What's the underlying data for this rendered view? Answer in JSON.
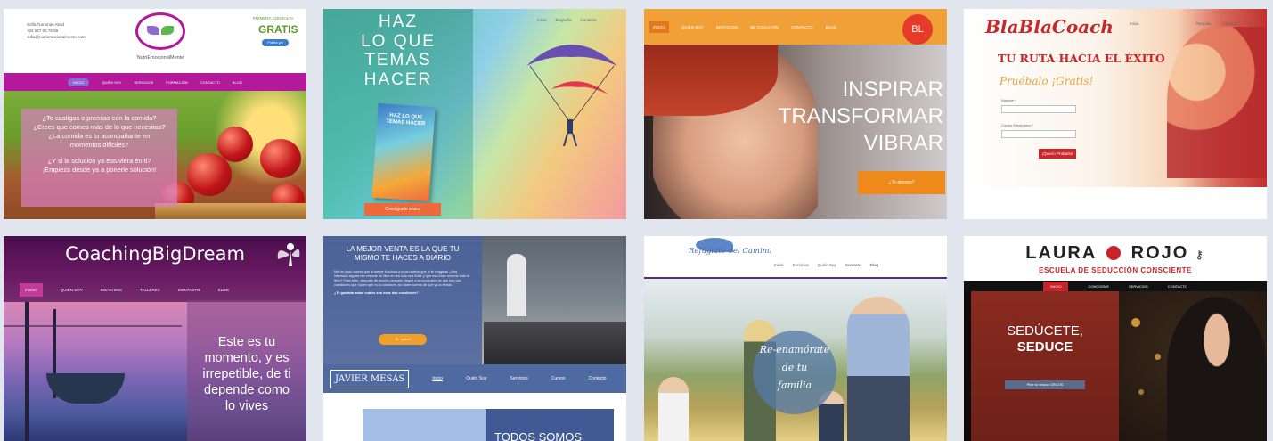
{
  "colors": {
    "page_bg": "#e1e6ee",
    "magenta": "#b31a9b",
    "orange": "#f0a037",
    "purple": "#6a1a63",
    "blue": "#4f6aa1",
    "red": "#c7242b"
  },
  "tiles": [
    {
      "name": "NutriEmocionalMente",
      "contact_name": "Sofía Turrionas Abad",
      "contact_phone": "+34 627 05 78 59",
      "contact_email": "sofia@nutriemocionalmente.com",
      "logo_text": "NutriEmocionalMente",
      "promo_1": "PRIMERA CONSULTA",
      "promo_2": "GRATIS",
      "promo_button": "Pídela ya!",
      "nav": [
        "INICIO",
        "QUIÉN SOY",
        "SERVICIOS",
        "FORMACIÓN",
        "CONTACTO",
        "BLOG"
      ],
      "quote": [
        "¿Te castigas o premias con la comida?",
        "¿Crees que comes más de lo que necesitas?",
        "¿La comida es tu acompañante en",
        "momentos difíciles?",
        "",
        "¿Y si la solución ya estuviera en ti?",
        "¡Empieza desde ya a ponerle solución!"
      ]
    },
    {
      "name": "Haz lo que temas hacer",
      "headline": [
        "HAZ",
        "LO QUE",
        "TEMAS",
        "HACER"
      ],
      "book_title": "HAZ LO QUE TEMAS HACER",
      "nav": [
        "Inicio",
        "Biografía",
        "Contacto"
      ],
      "cta": "Consíguelo ahora"
    },
    {
      "name": "Inspirar Transformar Vibrar",
      "nav": [
        "INICIO",
        "QUIÉN SOY",
        "SERVICIOS",
        "BE COACH ON",
        "CONTACTO",
        "BLOG"
      ],
      "mark": "BL",
      "lines": [
        "INSPIRAR",
        "TRANSFORMAR",
        "VIBRAR"
      ],
      "cta": "¿Te atreves?"
    },
    {
      "name": "BlaBlaCoach",
      "brand": "BlaBlaCoach",
      "nav": [
        "Inicio",
        "Terapias",
        "Contacto",
        "Blog"
      ],
      "headline": "TU RUTA HACIA EL ÉXITO",
      "subhead": "Pruébalo ¡Gratis!",
      "field_1": "Nombre *",
      "field_2": "Correo Electrónico *",
      "button": "¡Quiero Probarlo!"
    },
    {
      "name": "CoachingBigDream",
      "brand": "CoachingBigDream",
      "nav": [
        "INICIO",
        "QUIÉN SOY",
        "COACHING",
        "TALLERES",
        "CONTACTO",
        "BLOG"
      ],
      "message": [
        "Este es tu",
        "momento, y es",
        "irrepetible, de ti",
        "depende como",
        "lo vives"
      ]
    },
    {
      "name": "Javier Mesas",
      "headline": "LA MEJOR VENTA ES LA QUE TU MISMO TE HACES A DIARIO",
      "body": "Me he dado cuenta que la mente funciona a unos niveles que ni te imaginas ¿Has intentado alguna vez resumir un libro en tan solo una frase y que esa frase resuma todo el libro? Pues bien, después de mucho pensarlo, llegué a la conclusión de que hay dos cuestiones que hacen que no lo alcances, sin darte cuenta de que ya lo tenías.",
      "question": "¿Te gustaría saber cuáles son esas dos cuestiones?",
      "cta": "Sí, quiero",
      "logo": "JAVIER MESAS",
      "nav": [
        "Inicio",
        "Quién Soy",
        "Servicios",
        "Cursos",
        "Contacto"
      ],
      "footer_text": "TODOS SOMOS"
    },
    {
      "name": "Refúgiate del Camino",
      "brand": "Refúgiate del Camino",
      "nav": [
        "Inicio",
        "Servicios",
        "Quién Soy",
        "Contacto",
        "Blog"
      ],
      "circle": [
        "Re-enamórate",
        "de tu",
        "familia"
      ]
    },
    {
      "name": "Laura Rojo",
      "brand_left": "LAURA",
      "brand_right": "ROJO",
      "subtitle": "ESCUELA DE SEDUCCIÓN CONSCIENTE",
      "nav": [
        "INICIO",
        "CONÓCEME",
        "SERVICIOS",
        "CONTACTO"
      ],
      "line_1": "SEDÚCETE,",
      "line_2": "SEDUCE",
      "cta": "Pide tu sesión GRATIS"
    }
  ]
}
